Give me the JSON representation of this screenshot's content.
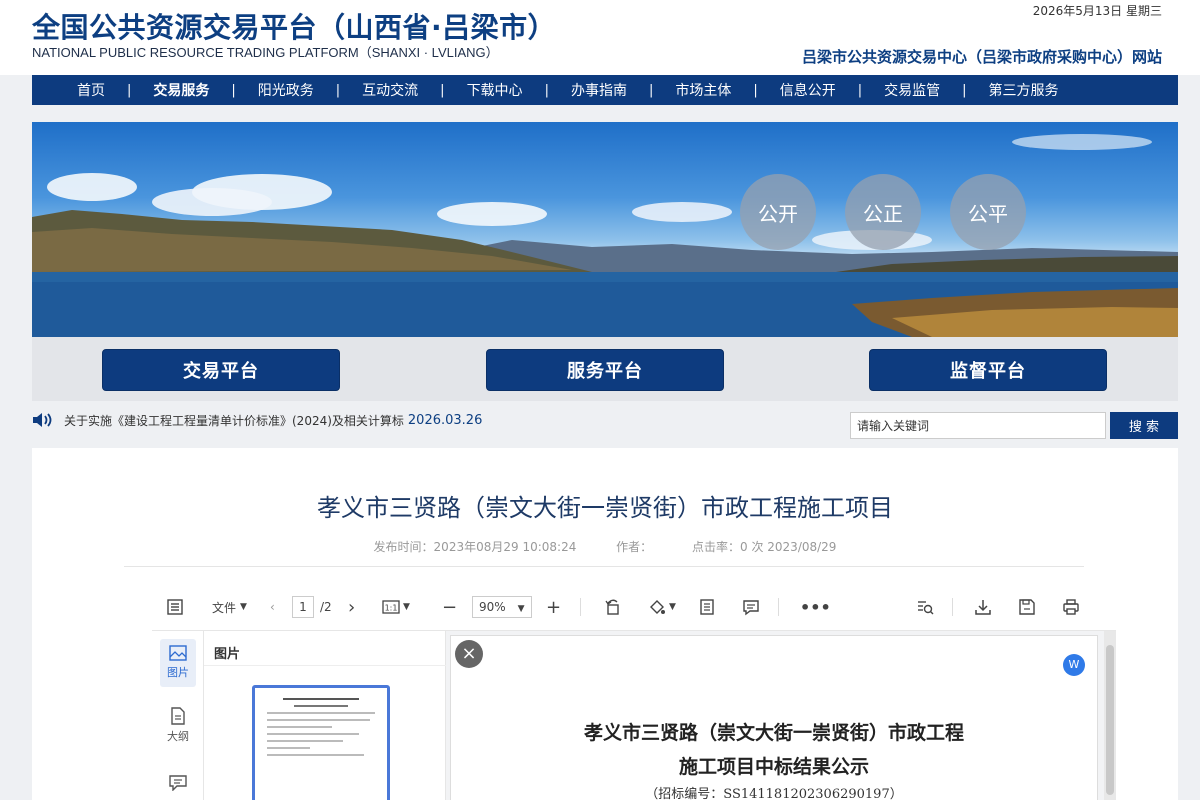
{
  "header": {
    "title_cn": "全国公共资源交易平台（山西省·吕梁市）",
    "title_en": "NATIONAL PUBLIC RESOURCE TRADING PLATFORM（SHANXI · LVLIANG）",
    "date": "2026年5月13日 星期三",
    "site_name": "吕梁市公共资源交易中心（吕梁市政府采购中心）网站"
  },
  "nav": {
    "items": [
      {
        "label": "首页"
      },
      {
        "label": "交易服务"
      },
      {
        "label": "阳光政务"
      },
      {
        "label": "互动交流"
      },
      {
        "label": "下载中心"
      },
      {
        "label": "办事指南"
      },
      {
        "label": "市场主体"
      },
      {
        "label": "信息公开"
      },
      {
        "label": "交易监管"
      },
      {
        "label": "第三方服务"
      }
    ],
    "separator": "|",
    "active_index": 1
  },
  "banner": {
    "circles": [
      "公开",
      "公正",
      "公平"
    ]
  },
  "platforms": {
    "trade": "交易平台",
    "service": "服务平台",
    "supervise": "监督平台"
  },
  "notice": {
    "text": "关于实施《建设工程工程量清单计价标准》(2024)及相关计算标",
    "date": "2026.03.26"
  },
  "search": {
    "value": "请输入关键词",
    "button": "搜 索"
  },
  "article": {
    "title": "孝义市三贤路（崇文大街一崇贤街）市政工程施工项目",
    "publish_time": "发布时间：2023年08月29 10:08:24",
    "author": "作者：",
    "clicks": "点击率：0 次 2023/08/29"
  },
  "viewer": {
    "file_menu": "文件",
    "current_page": "1",
    "total_pages": "/2",
    "zoom": "90%",
    "rail_images": "图片",
    "rail_outline": "大纲",
    "thumb_panel_title": "图片",
    "close": "×",
    "w_badge": "W",
    "doc_title_line1": "孝义市三贤路（崇文大街一崇贤街）市政工程",
    "doc_title_line2": "施工项目中标结果公示",
    "doc_code": "（招标编号：SS141181202306290197）"
  },
  "colors": {
    "primary": "#0d3b7f",
    "title": "#0d3f82",
    "accent_blue": "#2f7ae8"
  }
}
